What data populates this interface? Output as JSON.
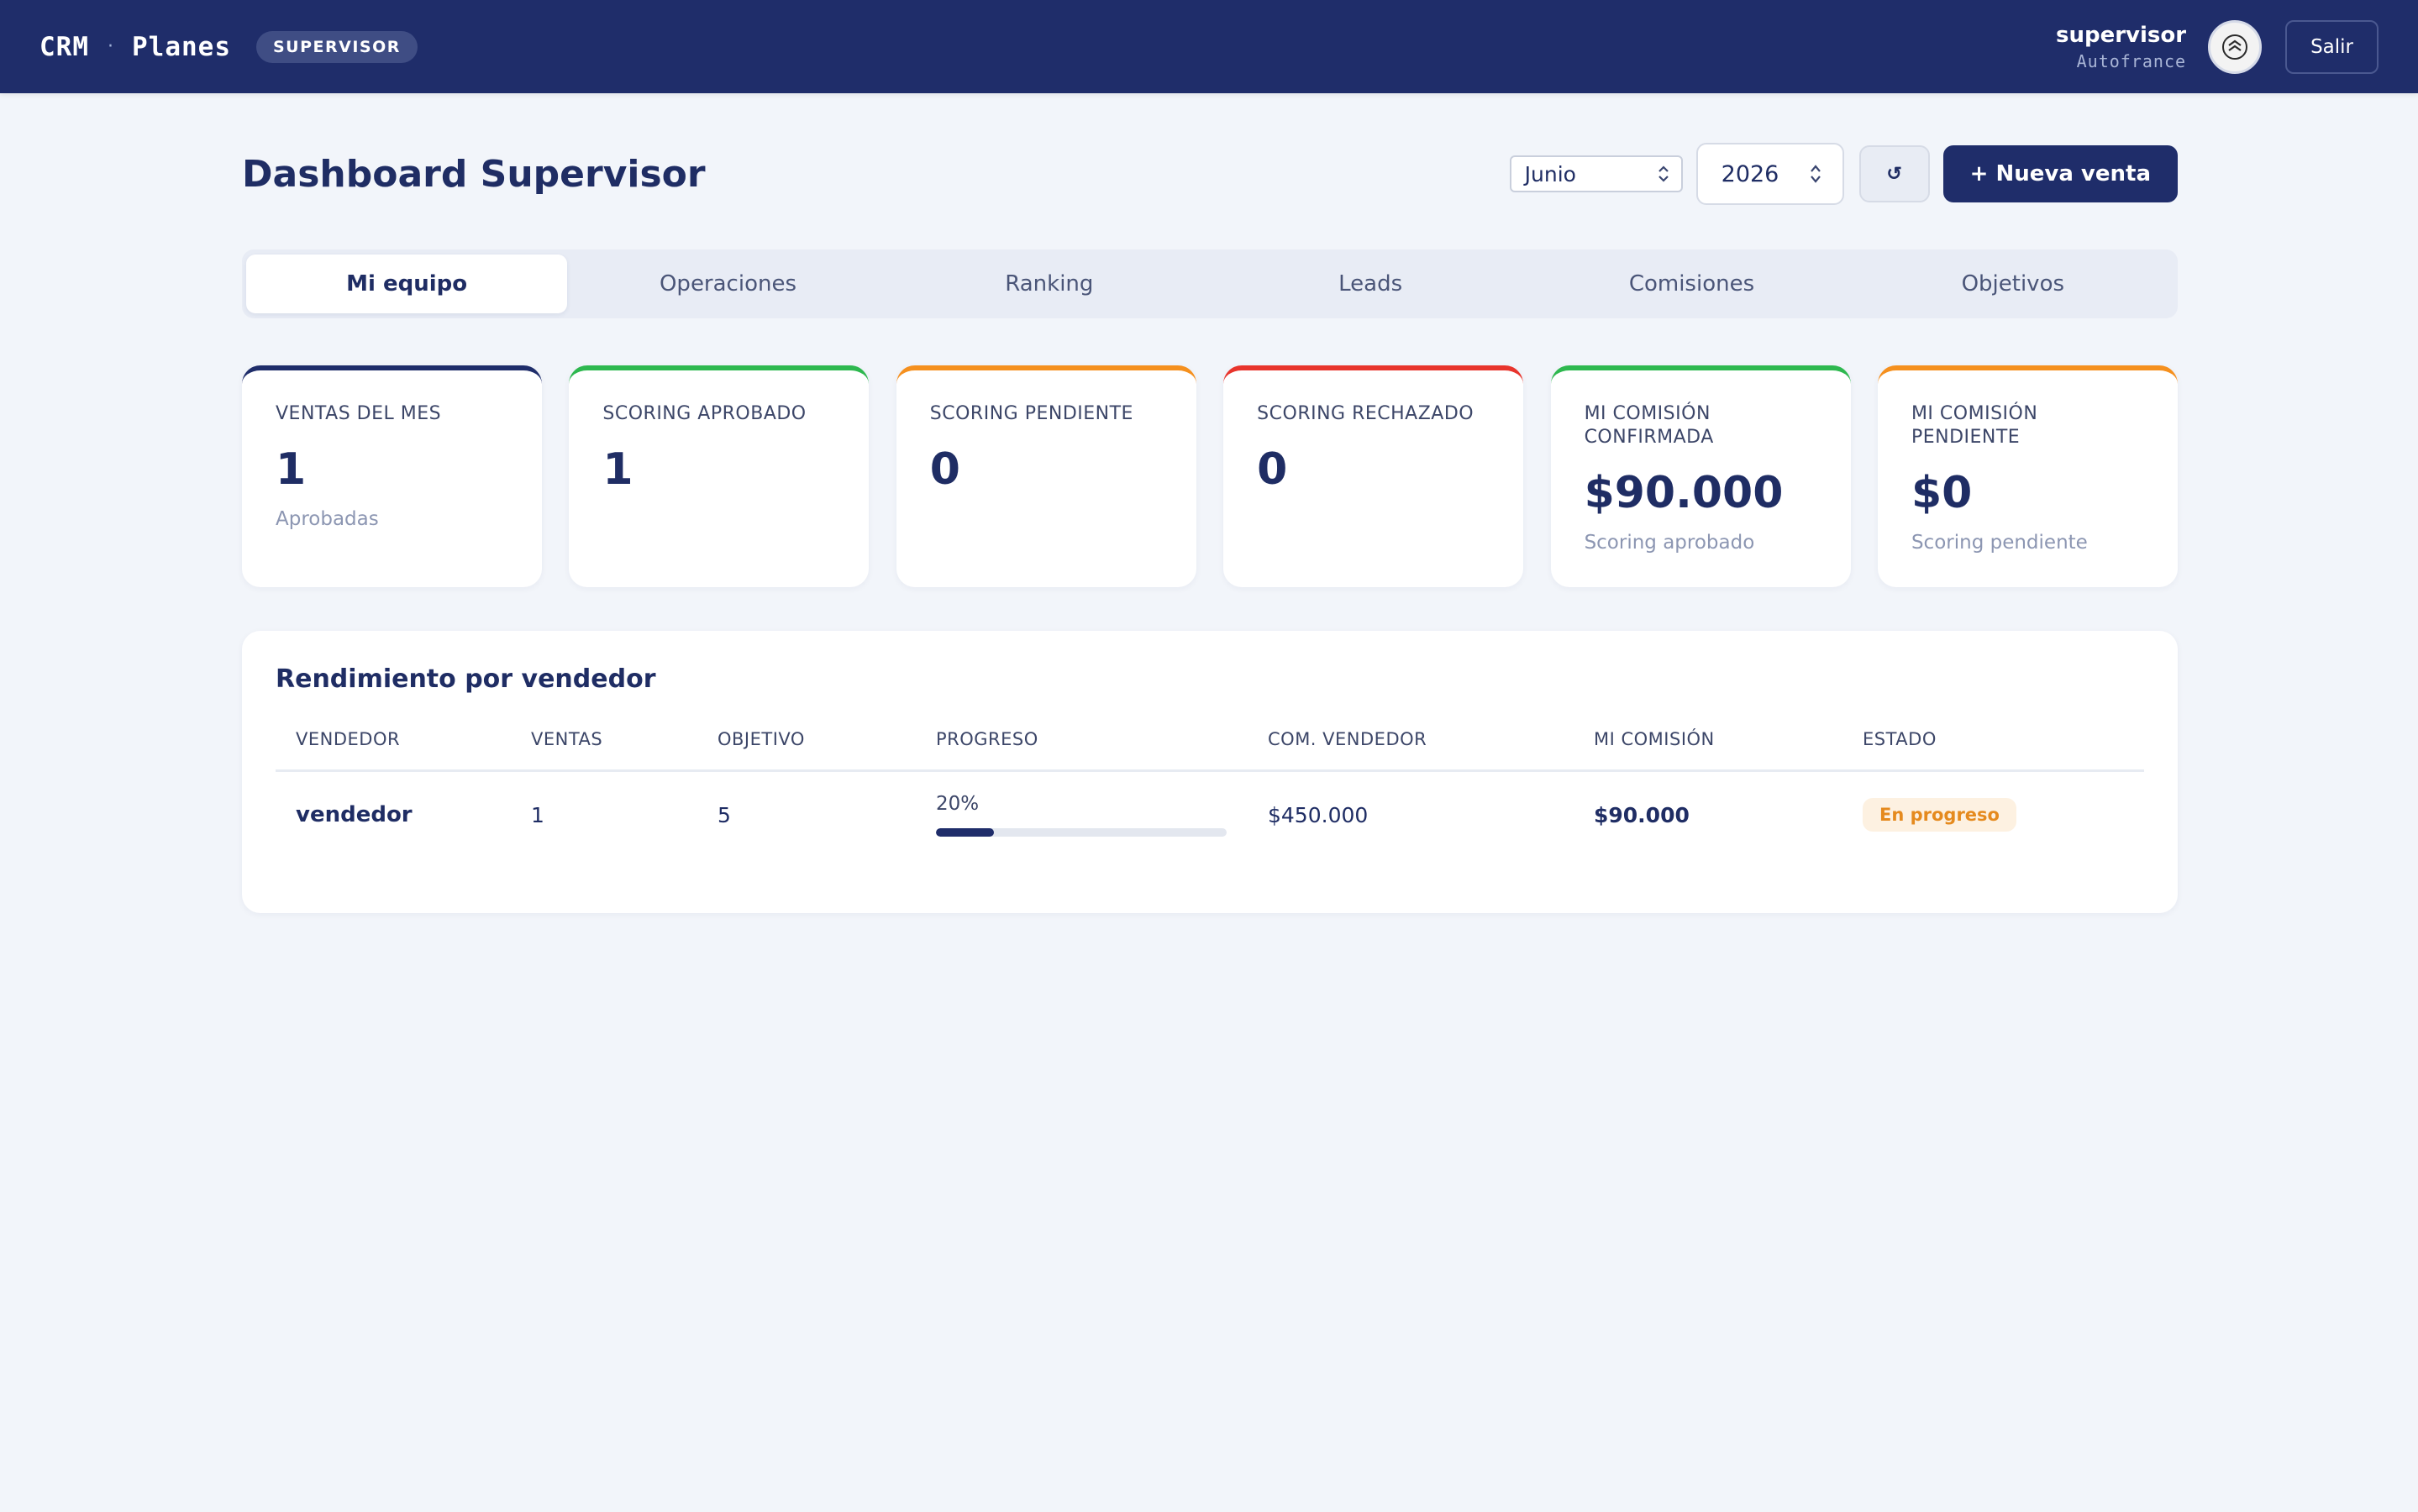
{
  "topbar": {
    "brand_left": "CRM",
    "brand_sep": "·",
    "brand_right": "Planes",
    "role": "SUPERVISOR",
    "user_name": "supervisor",
    "company": "Autofrance",
    "logout_label": "Salir"
  },
  "header": {
    "title": "Dashboard Supervisor",
    "month": "Junio",
    "year": "2026",
    "refresh_label": "↺",
    "new_sale_label": "+ Nueva venta"
  },
  "tabs": [
    {
      "label": "Mi equipo"
    },
    {
      "label": "Operaciones"
    },
    {
      "label": "Ranking"
    },
    {
      "label": "Leads"
    },
    {
      "label": "Comisiones"
    },
    {
      "label": "Objetivos"
    }
  ],
  "cards": [
    {
      "label": "VENTAS DEL MES",
      "value": "1",
      "sub": "Aprobadas",
      "color": "#1f2d6a"
    },
    {
      "label": "SCORING APROBADO",
      "value": "1",
      "sub": "",
      "color": "#2eb84f"
    },
    {
      "label": "SCORING PENDIENTE",
      "value": "0",
      "sub": "",
      "color": "#f5901e"
    },
    {
      "label": "SCORING RECHAZADO",
      "value": "0",
      "sub": "",
      "color": "#e8342c"
    },
    {
      "label": "MI COMISIÓN CONFIRMADA",
      "value": "$90.000",
      "sub": "Scoring aprobado",
      "color": "#2eb84f"
    },
    {
      "label": "MI COMISIÓN PENDIENTE",
      "value": "$0",
      "sub": "Scoring pendiente",
      "color": "#f5901e"
    }
  ],
  "performance": {
    "title": "Rendimiento por vendedor",
    "columns": [
      "VENDEDOR",
      "VENTAS",
      "OBJETIVO",
      "PROGRESO",
      "COM. VENDEDOR",
      "MI COMISIÓN",
      "ESTADO"
    ],
    "rows": [
      {
        "seller": "vendedor",
        "sales": "1",
        "target": "5",
        "progress_text": "20%",
        "progress": 0.2,
        "seller_commission": "$450.000",
        "my_commission": "$90.000",
        "status": "En progreso"
      }
    ]
  }
}
